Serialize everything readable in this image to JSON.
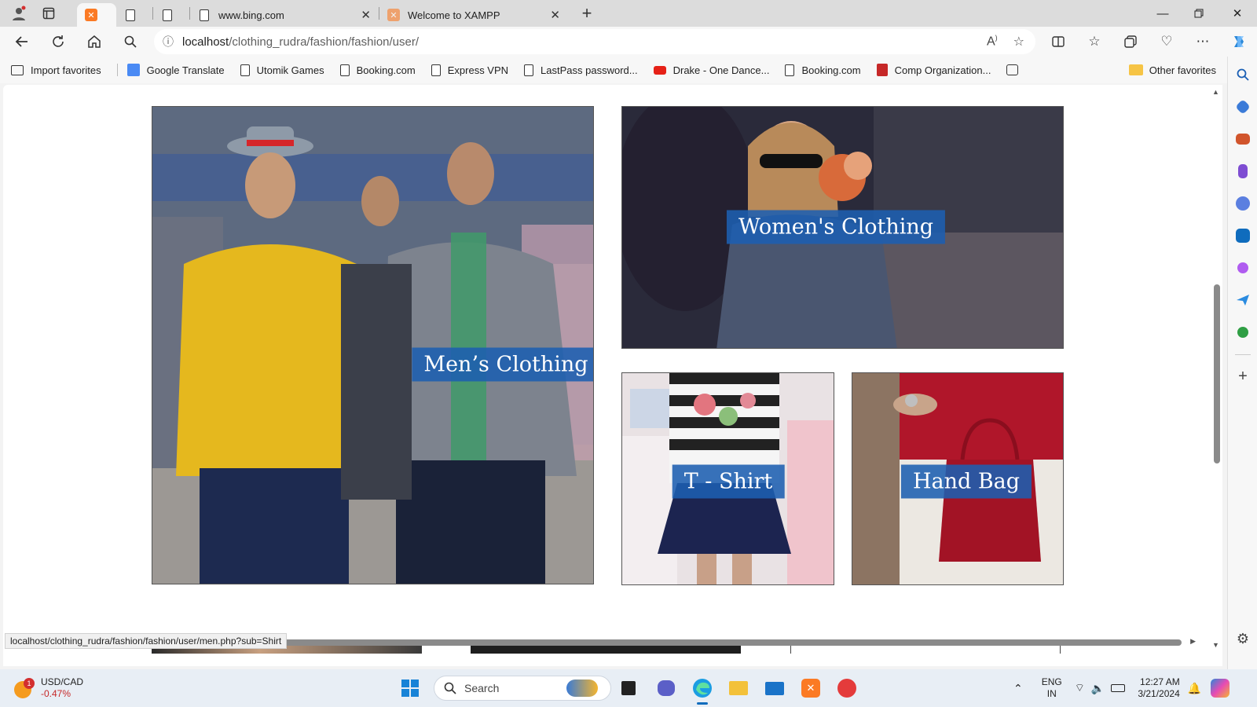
{
  "browser": {
    "tabs": [
      {
        "label": "",
        "icon": "xampp-icon",
        "active": true
      },
      {
        "label": "",
        "icon": "page-icon"
      },
      {
        "label": "",
        "icon": "page-icon"
      },
      {
        "label": "www.bing.com",
        "icon": "bing-page-icon"
      },
      {
        "label": "Welcome to XAMPP",
        "icon": "xampp-icon"
      }
    ],
    "address": {
      "host": "localhost",
      "path": "/clothing_rudra/fashion/fashion/user/"
    },
    "favorites": [
      {
        "label": "Import favorites",
        "icon": "import-icon"
      },
      {
        "label": "Google Translate",
        "icon": "translate-icon"
      },
      {
        "label": "Utomik Games",
        "icon": "page-icon"
      },
      {
        "label": "Booking.com",
        "icon": "page-icon"
      },
      {
        "label": "Express VPN",
        "icon": "page-icon"
      },
      {
        "label": "LastPass password...",
        "icon": "page-icon"
      },
      {
        "label": "Drake - One Dance...",
        "icon": "youtube-icon"
      },
      {
        "label": "Booking.com",
        "icon": "page-icon"
      },
      {
        "label": "Comp Organization...",
        "icon": "pdf-icon"
      }
    ],
    "other_favorites": "Other favorites",
    "status_url": "localhost/clothing_rudra/fashion/fashion/user/men.php?sub=Shirt"
  },
  "page": {
    "categories": [
      {
        "label": "Men’s Clothing",
        "key": "men"
      },
      {
        "label": "Women's Clothing",
        "key": "women"
      },
      {
        "label": "T - Shirt",
        "key": "tshirt"
      },
      {
        "label": "Hand Bag",
        "key": "handbag"
      }
    ]
  },
  "taskbar": {
    "widget": {
      "pair": "USD/CAD",
      "change": "-0.47%",
      "badge": "1"
    },
    "search_placeholder": "Search",
    "lang": "ENG",
    "region": "IN",
    "time": "12:27 AM",
    "date": "3/21/2024"
  },
  "colors": {
    "label_bg": "#1c5eb0",
    "accent": "#0f6cbd",
    "xampp": "#fb7a24"
  }
}
